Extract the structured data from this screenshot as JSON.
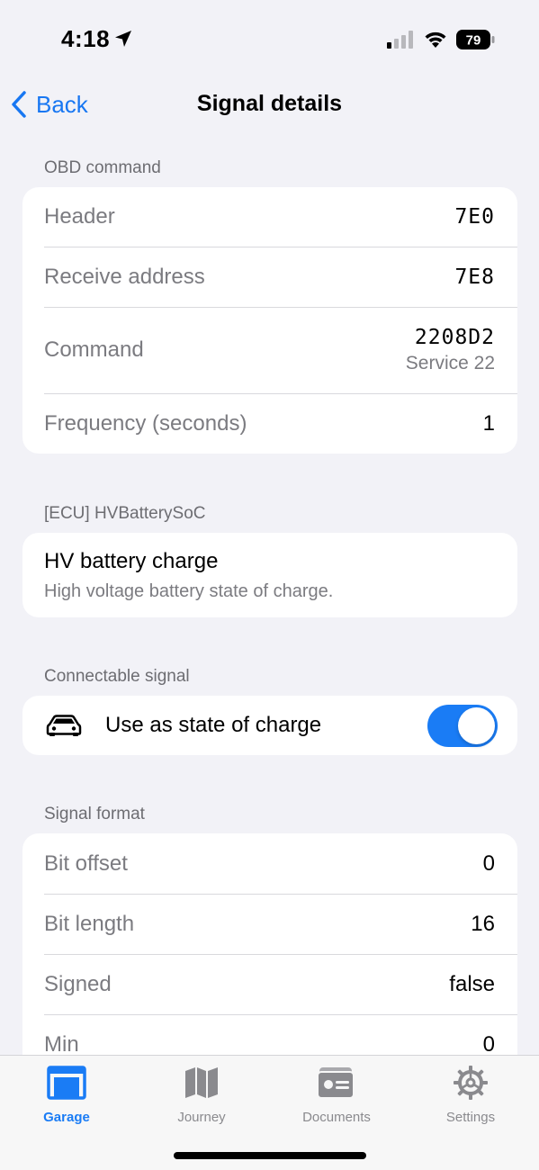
{
  "status_bar": {
    "time": "4:18",
    "battery_level": "79",
    "location_icon": "location-arrow-icon",
    "signal_icon": "cellular-signal-icon",
    "wifi_icon": "wifi-icon"
  },
  "nav": {
    "back_label": "Back",
    "title": "Signal details"
  },
  "obd_command": {
    "header": "OBD command",
    "rows": [
      {
        "label": "Header",
        "value": "7E0"
      },
      {
        "label": "Receive address",
        "value": "7E8"
      },
      {
        "label": "Command",
        "value": "2208D2",
        "sub": "Service 22"
      },
      {
        "label": "Frequency (seconds)",
        "value": "1"
      }
    ]
  },
  "ecu_signal": {
    "header": "[ECU] HVBatterySoC",
    "title": "HV battery charge",
    "description": "High voltage battery state of charge."
  },
  "connectable": {
    "header": "Connectable signal",
    "label": "Use as state of charge",
    "icon": "car-icon",
    "enabled": true
  },
  "signal_format": {
    "header": "Signal format",
    "rows": [
      {
        "label": "Bit offset",
        "value": "0"
      },
      {
        "label": "Bit length",
        "value": "16"
      },
      {
        "label": "Signed",
        "value": "false"
      },
      {
        "label": "Min",
        "value": "0"
      }
    ]
  },
  "tabs": [
    {
      "label": "Garage",
      "icon": "garage-icon",
      "active": true
    },
    {
      "label": "Journey",
      "icon": "map-icon",
      "active": false
    },
    {
      "label": "Documents",
      "icon": "documents-icon",
      "active": false
    },
    {
      "label": "Settings",
      "icon": "gear-icon",
      "active": false
    }
  ],
  "colors": {
    "accent": "#1a7cf5",
    "background": "#f2f2f7",
    "secondary_text": "#7b7b80"
  }
}
